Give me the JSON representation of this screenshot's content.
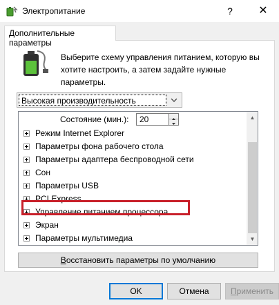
{
  "window": {
    "title": "Электропитание",
    "help_label": "?",
    "close_label": "✕"
  },
  "tab": {
    "label": "Дополнительные параметры"
  },
  "description": "Выберите схему управления питанием, которую вы хотите настроить, а затем задайте нужные параметры.",
  "plan_select": {
    "value": "Высокая производительность"
  },
  "state": {
    "label": "Состояние (мин.):",
    "value": "20"
  },
  "tree_items": [
    {
      "label": "Режим Internet Explorer"
    },
    {
      "label": "Параметры фона рабочего стола"
    },
    {
      "label": "Параметры адаптера беспроводной сети"
    },
    {
      "label": "Сон"
    },
    {
      "label": "Параметры USB"
    },
    {
      "label": "PCI Express"
    },
    {
      "label": "Управление питанием процессора",
      "highlighted": true
    },
    {
      "label": "Экран"
    },
    {
      "label": "Параметры мультимедиа"
    }
  ],
  "restore_button": {
    "pre": "",
    "underlined": "В",
    "post": "осстановить параметры по умолчанию"
  },
  "buttons": {
    "ok": "OK",
    "cancel": "Отмена",
    "apply_underlined": "П",
    "apply_rest": "рименить"
  },
  "colors": {
    "highlight": "#c8202a",
    "focus": "#0078d7"
  }
}
